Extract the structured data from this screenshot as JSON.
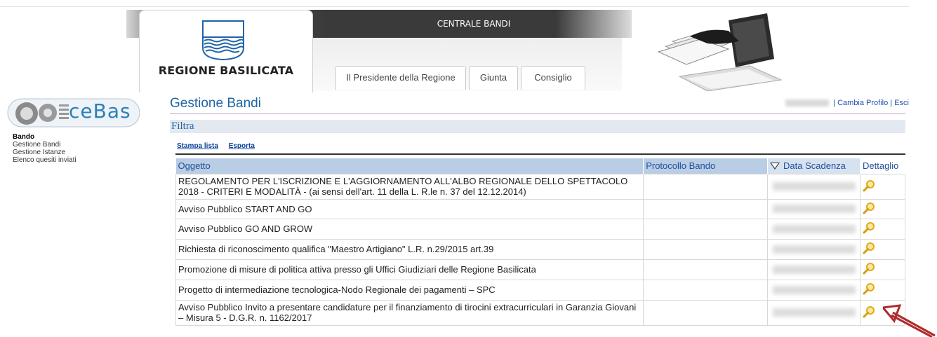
{
  "header": {
    "region_name": "REGIONE BASILICATA",
    "banner_title": "CENTRALE BANDI",
    "tabs": [
      {
        "label": "Il Presidente della Regione"
      },
      {
        "label": "Giunta"
      },
      {
        "label": "Consiglio"
      }
    ]
  },
  "sidebar": {
    "logo_text": "ceBas",
    "section_title": "Bando",
    "items": [
      {
        "label": "Gestione Bandi"
      },
      {
        "label": "Gestione Istanze"
      },
      {
        "label": "Elenco quesiti inviati"
      }
    ]
  },
  "main": {
    "page_title": "Gestione Bandi",
    "user_links": {
      "separator1": "|",
      "change_profile": "Cambia Profilo",
      "separator2": "|",
      "logout": "Esci"
    },
    "filter_label": "Filtra",
    "actions": {
      "print": "Stampa lista",
      "export": "Esporta"
    },
    "table": {
      "columns": [
        "Oggetto",
        "Protocollo Bando",
        "Data Scadenza",
        "Dettaglio"
      ],
      "sorted_column": "Data Scadenza",
      "rows": [
        {
          "oggetto": "REGOLAMENTO PER L'ISCRIZIONE E L'AGGIORNAMENTO ALL'ALBO REGIONALE DELLO SPETTACOLO 2018 - CRITERI E MODALITÀ - (ai sensi dell'art. 11 della L. R.le n. 37 del 12.12.2014)",
          "protocollo": ""
        },
        {
          "oggetto": "Avviso Pubblico START AND GO",
          "protocollo": ""
        },
        {
          "oggetto": "Avviso Pubblico GO AND GROW",
          "protocollo": ""
        },
        {
          "oggetto": "Richiesta di riconoscimento qualifica \"Maestro Artigiano\" L.R. n.29/2015 art.39",
          "protocollo": ""
        },
        {
          "oggetto": "Promozione di misure di politica attiva presso gli Uffici Giudiziari delle Regione Basilicata",
          "protocollo": ""
        },
        {
          "oggetto": "Progetto di intermediazione tecnologica-Nodo Regionale dei pagamenti – SPC",
          "protocollo": ""
        },
        {
          "oggetto": "Avviso Pubblico Invito a presentare candidature per il finanziamento di tirocini extracurriculari in Garanzia Giovani – Misura 5 - D.G.R. n. 1162/2017",
          "protocollo": ""
        }
      ]
    }
  },
  "colors": {
    "title_blue": "#1f66a5",
    "header_row": "#b9cde5",
    "arrow_red": "#b02a2a",
    "magnifier": "#e6b422"
  },
  "icons": {
    "detail": "magnifier-icon",
    "sort": "sort-descending-icon",
    "pointer": "red-arrow-icon"
  }
}
